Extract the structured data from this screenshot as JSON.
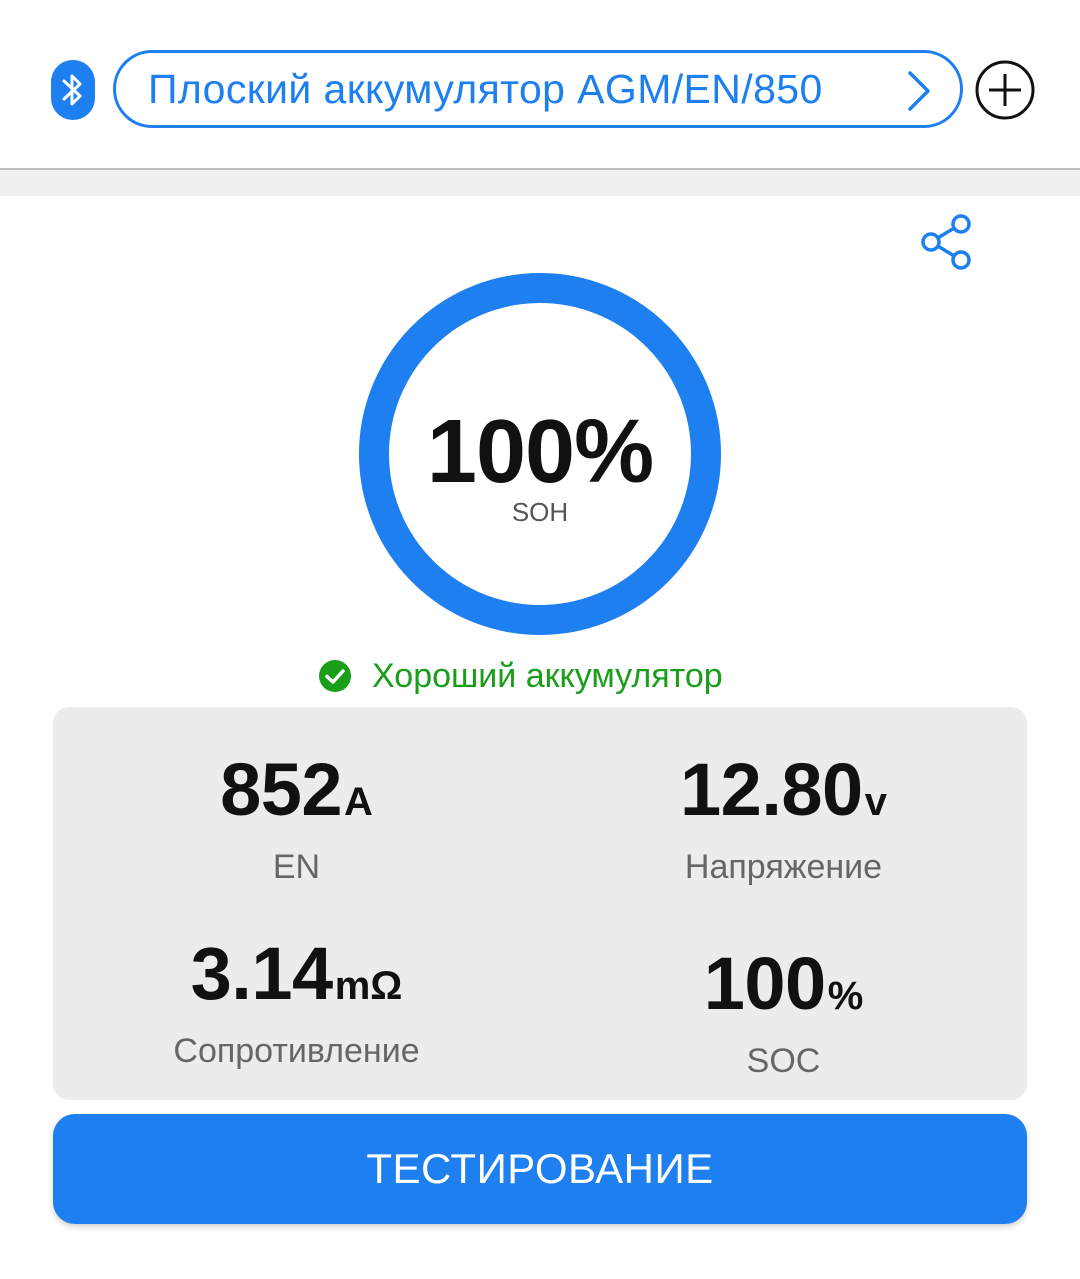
{
  "header": {
    "battery_selector_label": "Плоский аккумулятор AGM/EN/850"
  },
  "gauge": {
    "value_text": "100%",
    "label": "SOH",
    "fill_fraction": 1.0
  },
  "status": {
    "text": "Хороший аккумулятор"
  },
  "metrics": {
    "en": {
      "value": "852",
      "unit": "A",
      "label": "EN"
    },
    "voltage": {
      "value": "12.80",
      "unit": "v",
      "label": "Напряжение"
    },
    "resistance": {
      "value": "3.14",
      "unit": "mΩ",
      "label": "Сопротивление"
    },
    "soc": {
      "value": "100",
      "unit": "%",
      "label": "SOC"
    }
  },
  "actions": {
    "test_label": "ТЕСТИРОВАНИЕ"
  },
  "colors": {
    "accent": "#1e7ff0",
    "status_good": "#1a9e1a",
    "panel_bg": "#ececec"
  },
  "icons": {
    "bluetooth": "bluetooth-icon",
    "chevron": "chevron-right-icon",
    "add": "plus-circle-icon",
    "share": "share-icon",
    "status": "check-circle-icon"
  }
}
